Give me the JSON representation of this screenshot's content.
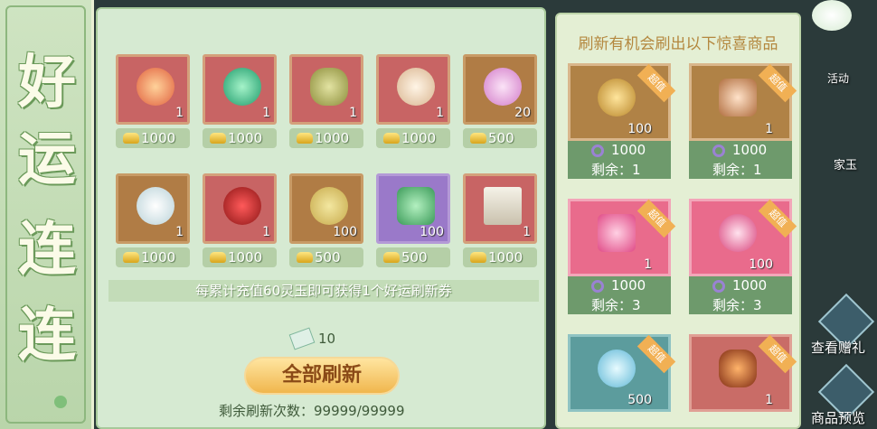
{
  "banner": {
    "chars": [
      "好",
      "运",
      "连",
      "连"
    ]
  },
  "grid": [
    {
      "qty": "1",
      "price": "1000",
      "bg": "red"
    },
    {
      "qty": "1",
      "price": "1000",
      "bg": "red"
    },
    {
      "qty": "1",
      "price": "1000",
      "bg": "red"
    },
    {
      "qty": "1",
      "price": "1000",
      "bg": "red"
    },
    {
      "qty": "20",
      "price": "500",
      "bg": "brown"
    },
    {
      "qty": "1",
      "price": "1000",
      "bg": "brown"
    },
    {
      "qty": "1",
      "price": "1000",
      "bg": "red"
    },
    {
      "qty": "100",
      "price": "500",
      "bg": "brown"
    },
    {
      "qty": "100",
      "price": "500",
      "bg": "purple"
    },
    {
      "qty": "1",
      "price": "1000",
      "bg": "red"
    }
  ],
  "note": "每累计充值60灵玉即可获得1个好运刷新券",
  "ticket_count": "10",
  "refresh_button": "全部刷新",
  "remaining_refresh": "剩余刷新次数：99999/99999",
  "right": {
    "header": "刷新有机会刷出以下惊喜商品",
    "ribbon": "超值",
    "cards": [
      {
        "qty": "100",
        "price": "1000",
        "left": "剩余：1",
        "bg": "brown"
      },
      {
        "qty": "1",
        "price": "1000",
        "left": "剩余：1",
        "bg": "brown"
      },
      {
        "qty": "1",
        "price": "1000",
        "left": "剩余：3",
        "bg": "pink"
      },
      {
        "qty": "100",
        "price": "1000",
        "left": "剩余：3",
        "bg": "pink"
      },
      {
        "qty": "500",
        "price": "",
        "left": "",
        "bg": "teal"
      },
      {
        "qty": "1",
        "price": "",
        "left": "",
        "bg": "red"
      }
    ]
  },
  "side": {
    "view_gifts": "查看赠礼",
    "preview": "商品预览",
    "hidden_label": "家玉",
    "activity": "活动"
  }
}
